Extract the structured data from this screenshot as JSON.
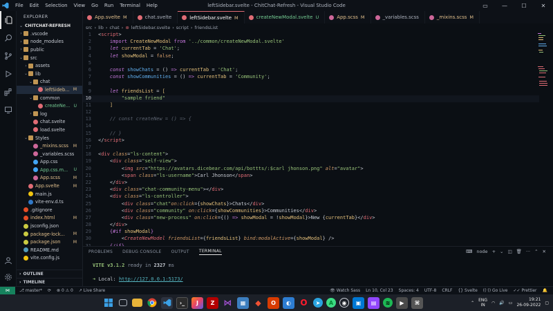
{
  "window": {
    "title": "leftSidebar.svelte - ChitChat-Refresh - Visual Studio Code",
    "menu": [
      "File",
      "Edit",
      "Selection",
      "View",
      "Go",
      "Run",
      "Terminal",
      "Help"
    ]
  },
  "sidebar": {
    "header": "EXPLORER",
    "project": "CHITCHAT-REFRESH",
    "items": [
      {
        "label": ".vscode",
        "depth": 1,
        "type": "folder",
        "open": false,
        "status": ""
      },
      {
        "label": "node_modules",
        "depth": 1,
        "type": "folder",
        "open": false,
        "status": ""
      },
      {
        "label": "public",
        "depth": 1,
        "type": "folder",
        "open": false,
        "status": ""
      },
      {
        "label": "src",
        "depth": 1,
        "type": "folder",
        "open": true,
        "status": ""
      },
      {
        "label": "assets",
        "depth": 2,
        "type": "folder",
        "open": false,
        "status": ""
      },
      {
        "label": "lib",
        "depth": 2,
        "type": "folder",
        "open": true,
        "status": ""
      },
      {
        "label": "chat",
        "depth": 3,
        "type": "folder",
        "open": true,
        "status": ""
      },
      {
        "label": "leftSideb...",
        "depth": 4,
        "type": "svelte",
        "open": false,
        "status": "M"
      },
      {
        "label": "common",
        "depth": 3,
        "type": "folder",
        "open": true,
        "status": ""
      },
      {
        "label": "createNe...",
        "depth": 4,
        "type": "svelte",
        "open": false,
        "status": "U"
      },
      {
        "label": "log",
        "depth": 3,
        "type": "folder",
        "open": false,
        "status": ""
      },
      {
        "label": "chat.svelte",
        "depth": 3,
        "type": "svelte",
        "open": false,
        "status": ""
      },
      {
        "label": "load.svelte",
        "depth": 3,
        "type": "svelte",
        "open": false,
        "status": ""
      },
      {
        "label": "Styles",
        "depth": 2,
        "type": "folder",
        "open": true,
        "status": ""
      },
      {
        "label": "_mixins.scss",
        "depth": 3,
        "type": "scss",
        "open": false,
        "status": "M"
      },
      {
        "label": "_variables.scss",
        "depth": 3,
        "type": "scss",
        "open": false,
        "status": ""
      },
      {
        "label": "App.css",
        "depth": 3,
        "type": "css",
        "open": false,
        "status": ""
      },
      {
        "label": "App.css.m...",
        "depth": 3,
        "type": "css",
        "open": false,
        "status": "U"
      },
      {
        "label": "App.scss",
        "depth": 3,
        "type": "scss",
        "open": false,
        "status": "M"
      },
      {
        "label": "App.svelte",
        "depth": 2,
        "type": "svelte",
        "open": false,
        "status": "M"
      },
      {
        "label": "main.js",
        "depth": 2,
        "type": "js",
        "open": false,
        "status": ""
      },
      {
        "label": "vite-env.d.ts",
        "depth": 2,
        "type": "ts",
        "open": false,
        "status": ""
      },
      {
        "label": ".gitignore",
        "depth": 1,
        "type": "git",
        "open": false,
        "status": ""
      },
      {
        "label": "index.html",
        "depth": 1,
        "type": "html",
        "open": false,
        "status": "M"
      },
      {
        "label": "jsconfig.json",
        "depth": 1,
        "type": "json",
        "open": false,
        "status": ""
      },
      {
        "label": "package-lock...",
        "depth": 1,
        "type": "json",
        "open": false,
        "status": "M"
      },
      {
        "label": "package.json",
        "depth": 1,
        "type": "json",
        "open": false,
        "status": "M"
      },
      {
        "label": "README.md",
        "depth": 1,
        "type": "md",
        "open": false,
        "status": ""
      },
      {
        "label": "vite.config.js",
        "depth": 1,
        "type": "js",
        "open": false,
        "status": ""
      }
    ],
    "outline": "OUTLINE",
    "timeline": "TIMELINE"
  },
  "tabs": [
    {
      "label": "App.svelte",
      "mark": "M",
      "active": false
    },
    {
      "label": "chat.svelte",
      "mark": "",
      "active": false
    },
    {
      "label": "leftSidebar.svelte",
      "mark": "M",
      "active": true
    },
    {
      "label": "createNewModal.svelte",
      "mark": "U",
      "active": false
    },
    {
      "label": "App.scss",
      "mark": "M",
      "active": false
    },
    {
      "label": "_variables.scss",
      "mark": "",
      "active": false
    },
    {
      "label": "_mixins.scss",
      "mark": "M",
      "active": false
    }
  ],
  "breadcrumb": [
    "src",
    "lib",
    "chat",
    "leftSidebar.svelte",
    "script",
    "friendsList"
  ],
  "editor": {
    "current_line": 10,
    "lines": [
      "1",
      "2",
      "3",
      "4",
      "5",
      "6",
      "7",
      "8",
      "9",
      "10",
      "11",
      "12",
      "13",
      "14",
      "15",
      "16",
      "17",
      "18",
      "19",
      "20",
      "21",
      "22",
      "23",
      "24",
      "25",
      "26",
      "27",
      "28",
      "29",
      "30",
      "31",
      "32",
      "33"
    ]
  },
  "panel": {
    "tabs": [
      "PROBLEMS",
      "DEBUG CONSOLE",
      "OUTPUT",
      "TERMINAL"
    ],
    "active_tab": "TERMINAL",
    "terminal_name": "node",
    "vite_label": "VITE",
    "vite_version": "v3.1.2",
    "ready_text": "ready in",
    "ready_ms": "2327",
    "ready_unit": "ms",
    "local_label": "Local:",
    "local_url": "http://127.0.0.1:5173/"
  },
  "statusbar": {
    "branch": "master*",
    "errors": "0",
    "warnings": "0",
    "live_share": "Live Share",
    "watch_sass": "Watch Sass",
    "position": "Ln 10, Col 23",
    "spaces": "Spaces: 4",
    "encoding": "UTF-8",
    "eol": "CRLF",
    "language": "Svelte",
    "go_live": "Go Live",
    "prettier": "Prettier"
  },
  "taskbar": {
    "lang": "ENG",
    "region": "IN",
    "time": "19:21",
    "date": "26-09-2022"
  },
  "colors": {
    "accent": "#16825d",
    "tab_active_border": "#e06c75"
  }
}
